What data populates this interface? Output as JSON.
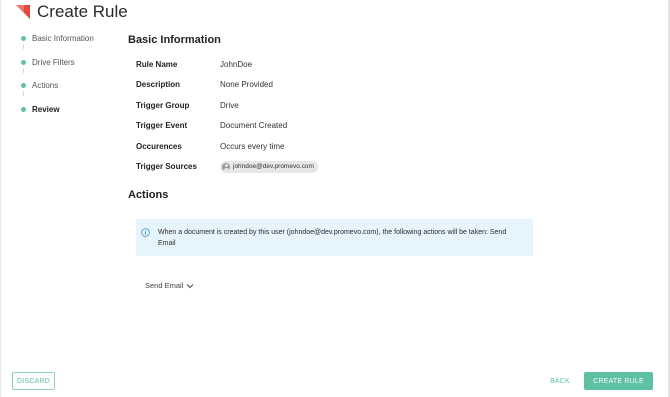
{
  "header": {
    "title": "Create Rule",
    "logo_icon": "red-flag-triangle",
    "logo_color": "#e04a3f"
  },
  "stepper": {
    "steps": [
      {
        "label": "Basic Information"
      },
      {
        "label": "Drive Filters"
      },
      {
        "label": "Actions"
      },
      {
        "label": "Review"
      }
    ],
    "active_step": "Review",
    "dot_color": "#5ec0a2"
  },
  "basic_info": {
    "title": "Basic Information",
    "rows": [
      {
        "label": "Rule Name",
        "value": "JohnDoe"
      },
      {
        "label": "Description",
        "value": "None Provided"
      },
      {
        "label": "Trigger Group",
        "value": "Drive"
      },
      {
        "label": "Trigger Event",
        "value": "Document Created"
      },
      {
        "label": "Occurences",
        "value": "Occurs every time"
      },
      {
        "label": "Trigger Sources",
        "chip": "johndoe@dev.promevo.com",
        "chip_icon": "user-avatar-icon"
      }
    ]
  },
  "actions": {
    "title": "Actions",
    "alert_icon": "info-circle-icon",
    "alert_text": "When a document is created by this user (johndoe@dev.promevo.com), the following actions will be taken: Send Email",
    "dropdown_label": "Send Email",
    "dropdown_icon": "chevron-down-icon"
  },
  "footer": {
    "discard_label": "DISCARD",
    "back_label": "BACK",
    "create_label": "CREATE RULE"
  },
  "colors": {
    "accent": "#5ec0a2",
    "alert_bg": "#e5f5fb",
    "info_icon": "#3a8fd1"
  }
}
